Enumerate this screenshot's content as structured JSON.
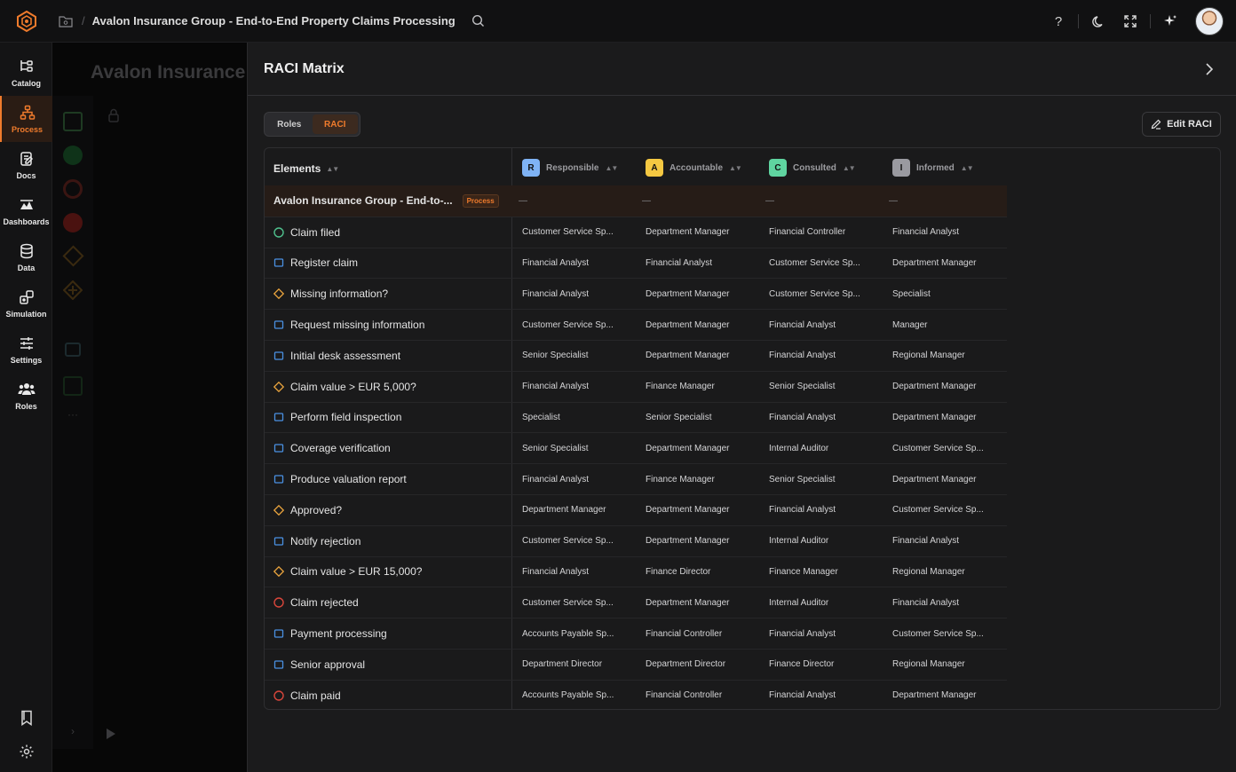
{
  "header": {
    "breadcrumb_sep": "/",
    "title": "Avalon Insurance Group - End-to-End Property Claims Processing",
    "icons": [
      "logo-icon",
      "folder-icon",
      "search-icon",
      "help-icon",
      "moon-icon",
      "expand-icon",
      "sparkle-icon"
    ],
    "help_glyph": "?"
  },
  "sidebar": {
    "items": [
      {
        "label": "Catalog",
        "icon": "catalog-icon"
      },
      {
        "label": "Process",
        "icon": "process-icon",
        "active": true
      },
      {
        "label": "Docs",
        "icon": "docs-icon"
      },
      {
        "label": "Dashboards",
        "icon": "dashboards-icon"
      },
      {
        "label": "Data",
        "icon": "data-icon"
      },
      {
        "label": "Simulation",
        "icon": "simulation-icon"
      },
      {
        "label": "Settings",
        "icon": "settings-sliders-icon"
      },
      {
        "label": "Roles",
        "icon": "roles-icon"
      }
    ],
    "bottom": [
      "bookmark-icon",
      "gear-icon"
    ]
  },
  "canvas": {
    "title": "Avalon Insurance Group - End-to-End Property Claims Processing"
  },
  "panel": {
    "title": "RACI Matrix",
    "tabs": [
      {
        "label": "Roles",
        "selected": false
      },
      {
        "label": "RACI",
        "selected": true
      }
    ],
    "edit_label": "Edit RACI",
    "columns": {
      "elements": "Elements",
      "roles": [
        {
          "letter": "R",
          "label": "Responsible",
          "color": "#7fb3f5"
        },
        {
          "letter": "A",
          "label": "Accountable",
          "color": "#f5c842"
        },
        {
          "letter": "C",
          "label": "Consulted",
          "color": "#5fd4a0"
        },
        {
          "letter": "I",
          "label": "Informed",
          "color": "#9a9aa0"
        }
      ]
    },
    "process_row": {
      "name": "Avalon Insurance Group - End-to-...",
      "badge": "Process",
      "values": [
        "—",
        "—",
        "—",
        "—"
      ]
    },
    "rows": [
      {
        "name": "Claim filed",
        "type": "start",
        "values": [
          "Customer Service Sp...",
          "Department Manager",
          "Financial Controller",
          "Financial Analyst"
        ]
      },
      {
        "name": "Register claim",
        "type": "task",
        "values": [
          "Financial Analyst",
          "Financial Analyst",
          "Customer Service Sp...",
          "Department Manager"
        ]
      },
      {
        "name": "Missing information?",
        "type": "gateway",
        "values": [
          "Financial Analyst",
          "Department Manager",
          "Customer Service Sp...",
          "Specialist"
        ]
      },
      {
        "name": "Request missing information",
        "type": "task",
        "values": [
          "Customer Service Sp...",
          "Department Manager",
          "Financial Analyst",
          "Manager"
        ]
      },
      {
        "name": "Initial desk assessment",
        "type": "task",
        "values": [
          "Senior Specialist",
          "Department Manager",
          "Financial Analyst",
          "Regional Manager"
        ]
      },
      {
        "name": "Claim value > EUR 5,000?",
        "type": "gateway",
        "values": [
          "Financial Analyst",
          "Finance Manager",
          "Senior Specialist",
          "Department Manager"
        ]
      },
      {
        "name": "Perform field inspection",
        "type": "task",
        "values": [
          "Specialist",
          "Senior Specialist",
          "Financial Analyst",
          "Department Manager"
        ]
      },
      {
        "name": "Coverage verification",
        "type": "task",
        "values": [
          "Senior Specialist",
          "Department Manager",
          "Internal Auditor",
          "Customer Service Sp..."
        ]
      },
      {
        "name": "Produce valuation report",
        "type": "task",
        "values": [
          "Financial Analyst",
          "Finance Manager",
          "Senior Specialist",
          "Department Manager"
        ]
      },
      {
        "name": "Approved?",
        "type": "gateway",
        "values": [
          "Department Manager",
          "Department Manager",
          "Financial Analyst",
          "Customer Service Sp..."
        ]
      },
      {
        "name": "Notify rejection",
        "type": "task",
        "values": [
          "Customer Service Sp...",
          "Department Manager",
          "Internal Auditor",
          "Financial Analyst"
        ]
      },
      {
        "name": "Claim value > EUR 15,000?",
        "type": "gateway",
        "values": [
          "Financial Analyst",
          "Finance Director",
          "Finance Manager",
          "Regional Manager"
        ]
      },
      {
        "name": "Claim rejected",
        "type": "end",
        "values": [
          "Customer Service Sp...",
          "Department Manager",
          "Internal Auditor",
          "Financial Analyst"
        ]
      },
      {
        "name": "Payment processing",
        "type": "task",
        "values": [
          "Accounts Payable Sp...",
          "Financial Controller",
          "Financial Analyst",
          "Customer Service Sp..."
        ]
      },
      {
        "name": "Senior approval",
        "type": "task",
        "values": [
          "Department Director",
          "Department Director",
          "Finance Director",
          "Regional Manager"
        ]
      },
      {
        "name": "Claim paid",
        "type": "end",
        "values": [
          "Accounts Payable Sp...",
          "Financial Controller",
          "Financial Analyst",
          "Department Manager"
        ]
      }
    ]
  },
  "colors": {
    "accent": "#ef7b2c",
    "start": "#4fc08d",
    "task": "#4a90e2",
    "gateway": "#e8a33d",
    "end": "#d9463b"
  }
}
